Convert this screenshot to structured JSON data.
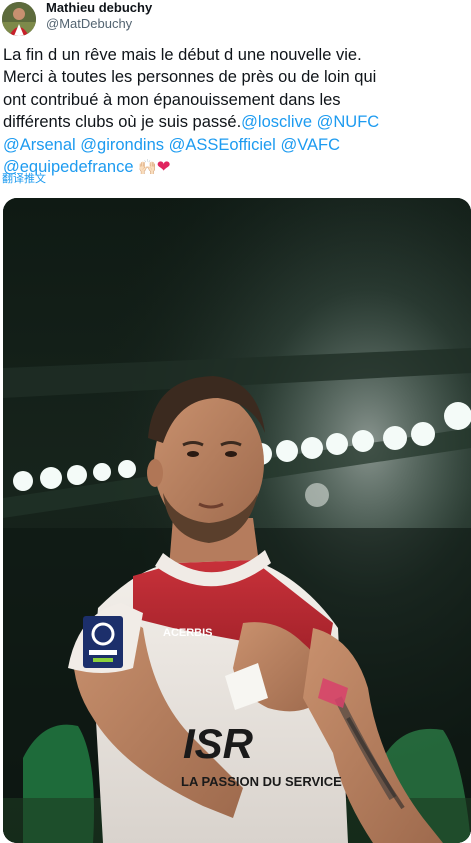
{
  "tweet": {
    "author": {
      "display_name": "Mathieu debuchy",
      "handle": "@MatDebuchy",
      "avatar": "player-avatar"
    },
    "text_lines": [
      {
        "parts": [
          {
            "text": "La fin d un rêve mais le début d une nouvelle vie.",
            "type": "text"
          }
        ]
      },
      {
        "parts": [
          {
            "text": "Merci à toutes les personnes de près ou de loin qui",
            "type": "text"
          }
        ]
      },
      {
        "parts": [
          {
            "text": "ont contribué à mon épanouissement dans les",
            "type": "text"
          }
        ]
      },
      {
        "parts": [
          {
            "text": "différents clubs où je suis passé.",
            "type": "text"
          },
          {
            "text": "@losclive",
            "type": "mention"
          },
          {
            "text": " ",
            "type": "text"
          },
          {
            "text": "@NUFC",
            "type": "mention"
          }
        ]
      },
      {
        "parts": [
          {
            "text": "@Arsenal",
            "type": "mention"
          },
          {
            "text": " ",
            "type": "text"
          },
          {
            "text": "@girondins",
            "type": "mention"
          },
          {
            "text": " ",
            "type": "text"
          },
          {
            "text": "@ASSEofficiel",
            "type": "mention"
          },
          {
            "text": " ",
            "type": "text"
          },
          {
            "text": "@VAFC",
            "type": "mention"
          }
        ]
      },
      {
        "parts": [
          {
            "text": "@equipedefrance",
            "type": "mention"
          },
          {
            "text": " ",
            "type": "text"
          }
        ]
      }
    ],
    "emoji": {
      "clap": "🙌🏻",
      "heart": "❤"
    },
    "translate_label": "翻译推文",
    "media": {
      "kind": "photo",
      "jersey_sponsor": "ISR",
      "jersey_tagline": "LA PASSION DU SERVICE",
      "sleeve_brand": "ACERBIS",
      "league_badge": "LIGUE 2 BKT"
    }
  },
  "colors": {
    "link": "#1d9bf0",
    "text": "#0f1419",
    "secondary": "#536471",
    "heart": "#e0245e"
  }
}
